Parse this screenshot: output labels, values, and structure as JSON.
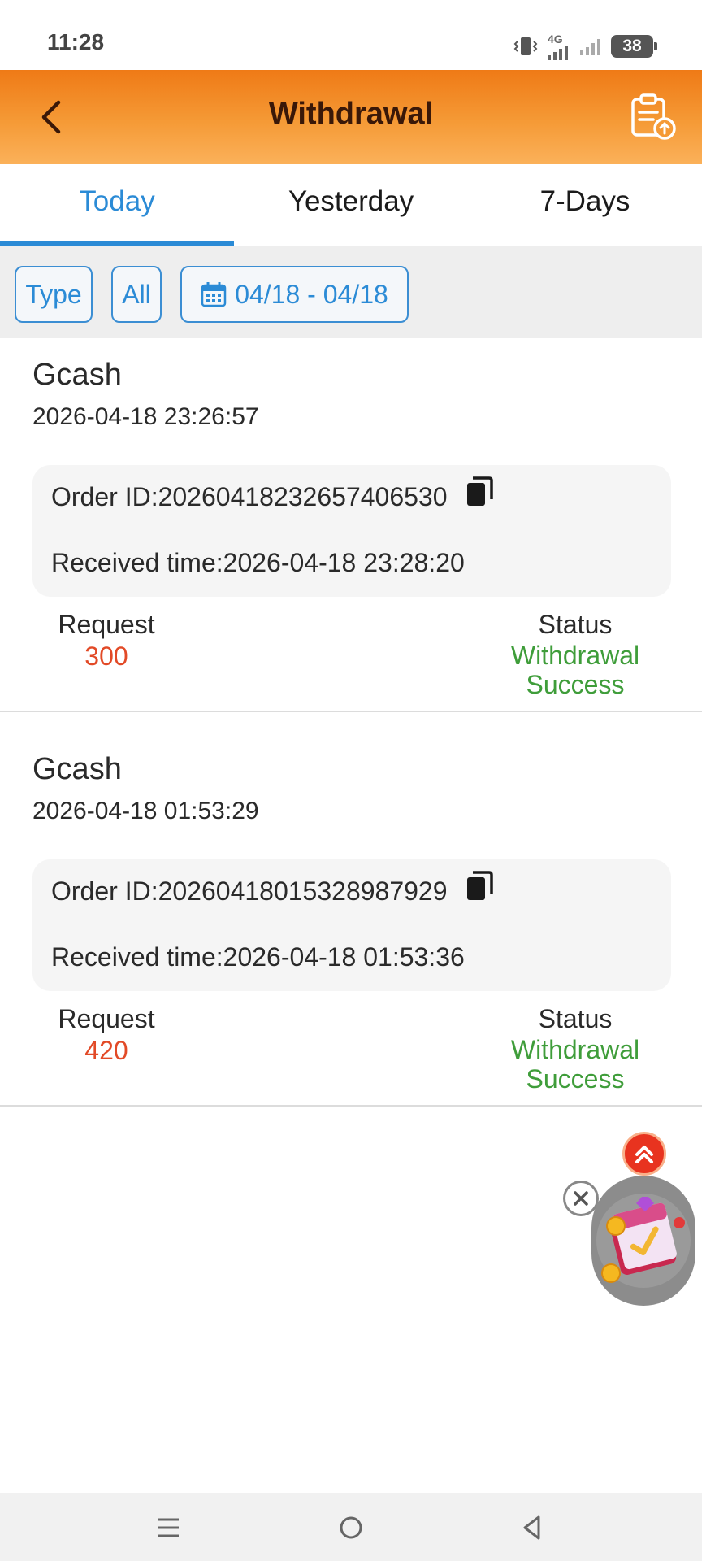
{
  "status_bar": {
    "time": "11:28",
    "network": "4G",
    "battery": "38",
    "icons": [
      "vibrate-icon",
      "signal-4g-icon",
      "signal-icon",
      "battery-icon"
    ]
  },
  "header": {
    "title": "Withdrawal",
    "back_icon": "chevron-left-icon",
    "history_icon": "clipboard-upload-icon"
  },
  "tabs": [
    {
      "label": "Today",
      "active": true
    },
    {
      "label": "Yesterday",
      "active": false
    },
    {
      "label": "7-Days",
      "active": false
    }
  ],
  "filters": {
    "type_label": "Type",
    "all_label": "All",
    "date_range": "04/18 - 04/18",
    "date_icon": "calendar-icon"
  },
  "records": [
    {
      "method": "Gcash",
      "time": "2026-04-18 23:26:57",
      "order_id": "Order ID:20260418232657406530",
      "received_time": "Received time:2026-04-18 23:28:20",
      "request_label": "Request",
      "request_amount": "300",
      "status_label": "Status",
      "status_line1": "Withdrawal",
      "status_line2": "Success"
    },
    {
      "method": "Gcash",
      "time": "2026-04-18 01:53:29",
      "order_id": "Order ID:20260418015328987929",
      "received_time": "Received time:2026-04-18 01:53:36",
      "request_label": "Request",
      "request_amount": "420",
      "status_label": "Status",
      "status_line1": "Withdrawal",
      "status_line2": "Success"
    }
  ],
  "colors": {
    "header_orange": "#ef7a16",
    "accent_blue": "#2b8bd6",
    "amount_red": "#e24a27",
    "success_green": "#3f9d3a"
  },
  "nav": {
    "icons": [
      "menu-icon",
      "home-icon",
      "back-triangle-icon"
    ]
  }
}
